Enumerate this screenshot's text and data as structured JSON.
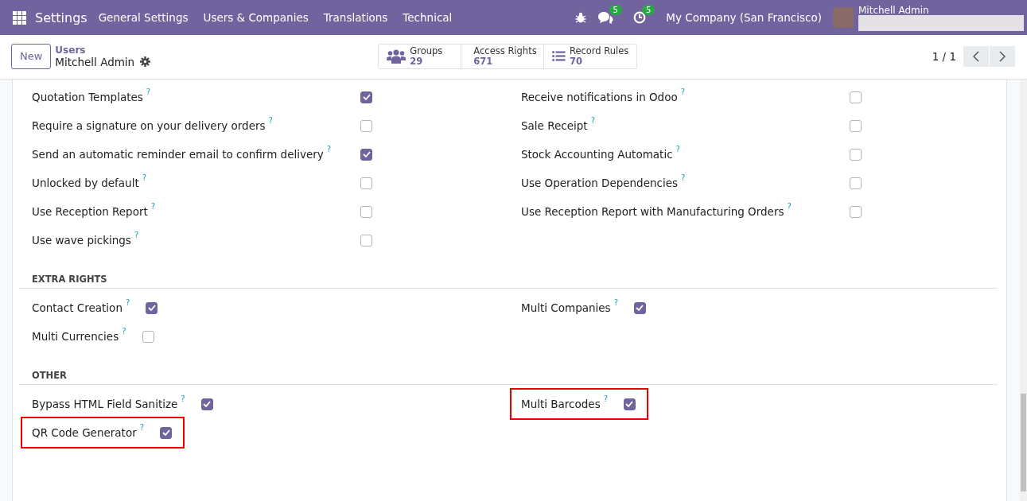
{
  "navbar": {
    "app_title": "Settings",
    "menu": [
      "General Settings",
      "Users & Companies",
      "Translations",
      "Technical"
    ],
    "messages_count": "5",
    "activities_count": "5",
    "company": "My Company (San Francisco)",
    "user_name": "Mitchell Admin"
  },
  "control_panel": {
    "new_button": "New",
    "breadcrumb": "Users",
    "record_title": "Mitchell Admin",
    "smart_buttons": [
      {
        "kind": "groups",
        "label": "Groups",
        "count": "29"
      },
      {
        "kind": "list",
        "label": "Access Rights",
        "count": "671"
      },
      {
        "kind": "list",
        "label": "Record Rules",
        "count": "70"
      }
    ],
    "pager": "1 / 1"
  },
  "sections": [
    {
      "kind": "wide",
      "columns": [
        [
          {
            "label": "Quotation Templates",
            "help": "?",
            "checked": true,
            "highlighted": false
          },
          {
            "label": "Require a signature on your delivery orders",
            "help": "?",
            "checked": false,
            "highlighted": false
          },
          {
            "label": "Send an automatic reminder email to confirm delivery",
            "help": "?",
            "checked": true,
            "highlighted": false
          },
          {
            "label": "Unlocked by default",
            "help": "?",
            "checked": false,
            "highlighted": false
          },
          {
            "label": "Use Reception Report",
            "help": "?",
            "checked": false,
            "highlighted": false
          },
          {
            "label": "Use wave pickings",
            "help": "?",
            "checked": false,
            "highlighted": false
          }
        ],
        [
          {
            "label": "Receive notifications in Odoo",
            "help": "?",
            "checked": false,
            "highlighted": false
          },
          {
            "label": "Sale Receipt",
            "help": "?",
            "checked": false,
            "highlighted": false
          },
          {
            "label": "Stock Accounting Automatic",
            "help": "?",
            "checked": false,
            "highlighted": false
          },
          {
            "label": "Use Operation Dependencies",
            "help": "?",
            "checked": false,
            "highlighted": false
          },
          {
            "label": "Use Reception Report with Manufacturing Orders",
            "help": "?",
            "checked": false,
            "highlighted": false
          }
        ]
      ]
    },
    {
      "kind": "narrow",
      "title": "EXTRA RIGHTS",
      "columns": [
        [
          {
            "label": "Contact Creation",
            "help": "?",
            "checked": true,
            "highlighted": false
          },
          {
            "label": "Multi Currencies",
            "help": "?",
            "checked": false,
            "highlighted": false
          }
        ],
        [
          {
            "label": "Multi Companies",
            "help": "?",
            "checked": true,
            "highlighted": false
          }
        ]
      ]
    },
    {
      "kind": "narrow",
      "title": "OTHER",
      "columns": [
        [
          {
            "label": "Bypass HTML Field Sanitize",
            "help": "?",
            "checked": true,
            "highlighted": false
          },
          {
            "label": "QR Code Generator",
            "help": "?",
            "checked": true,
            "highlighted": true
          }
        ],
        [
          {
            "label": "Multi Barcodes",
            "help": "?",
            "checked": true,
            "highlighted": true
          }
        ]
      ]
    }
  ]
}
